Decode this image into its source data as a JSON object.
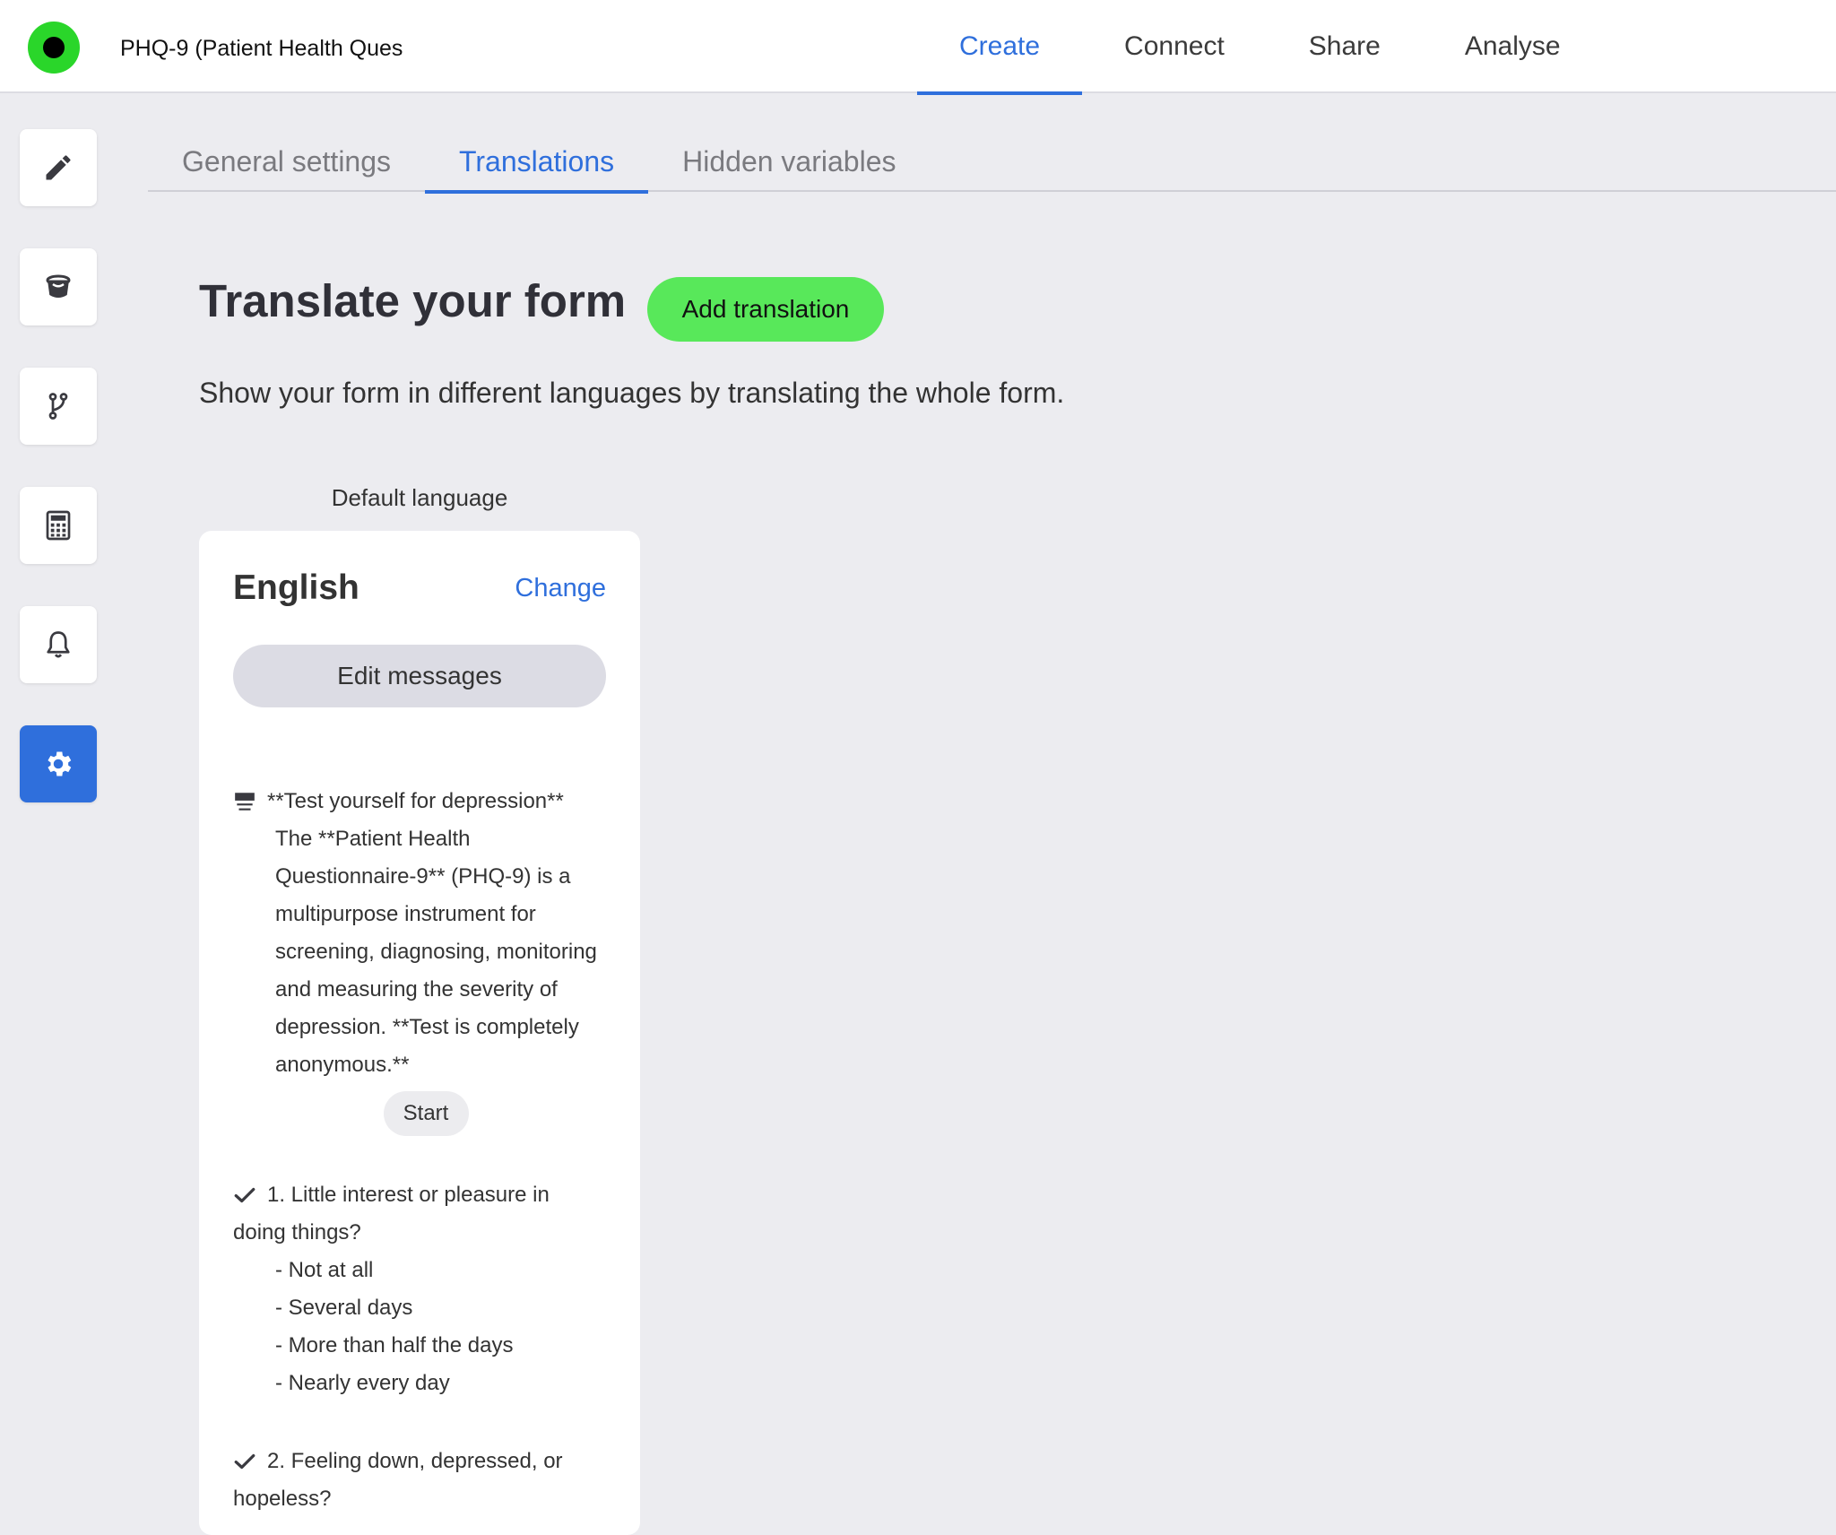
{
  "header": {
    "form_title": "PHQ-9 (Patient Health Ques",
    "nav": [
      "Create",
      "Connect",
      "Share",
      "Analyse"
    ],
    "active_nav": "Create"
  },
  "sidebar": {
    "items": [
      {
        "icon": "pencil-icon"
      },
      {
        "icon": "paint-bucket-icon"
      },
      {
        "icon": "logic-branch-icon"
      },
      {
        "icon": "calculator-icon"
      },
      {
        "icon": "bell-icon"
      },
      {
        "icon": "gear-icon",
        "active": true
      }
    ]
  },
  "subtabs": [
    "General settings",
    "Translations",
    "Hidden variables"
  ],
  "active_subtab": "Translations",
  "main": {
    "heading": "Translate your form",
    "add_button": "Add translation",
    "subtitle": "Show your form in different languages by translating the whole form.",
    "default_label": "Default language"
  },
  "card": {
    "language": "English",
    "change": "Change",
    "edit_messages": "Edit messages",
    "welcome": {
      "title": "**Test yourself for depression**",
      "lines": [
        "The **Patient Health",
        "Questionnaire-9** (PHQ-9) is a",
        "multipurpose instrument for",
        "screening, diagnosing, monitoring",
        "and measuring the severity of",
        "depression. **Test is completely",
        "anonymous.**"
      ],
      "start": "Start"
    },
    "questions": [
      {
        "line1": "1. Little interest or pleasure in",
        "line2": "doing things?",
        "options": [
          "- Not at all",
          "- Several days",
          "- More than half the days",
          "- Nearly every day"
        ]
      },
      {
        "line1": "2. Feeling down, depressed, or",
        "line2": "hopeless?"
      }
    ]
  },
  "colors": {
    "accent": "#2f6fdc",
    "add_button": "#58e85a",
    "logo": "#2ad62a",
    "background": "#ececf0"
  }
}
